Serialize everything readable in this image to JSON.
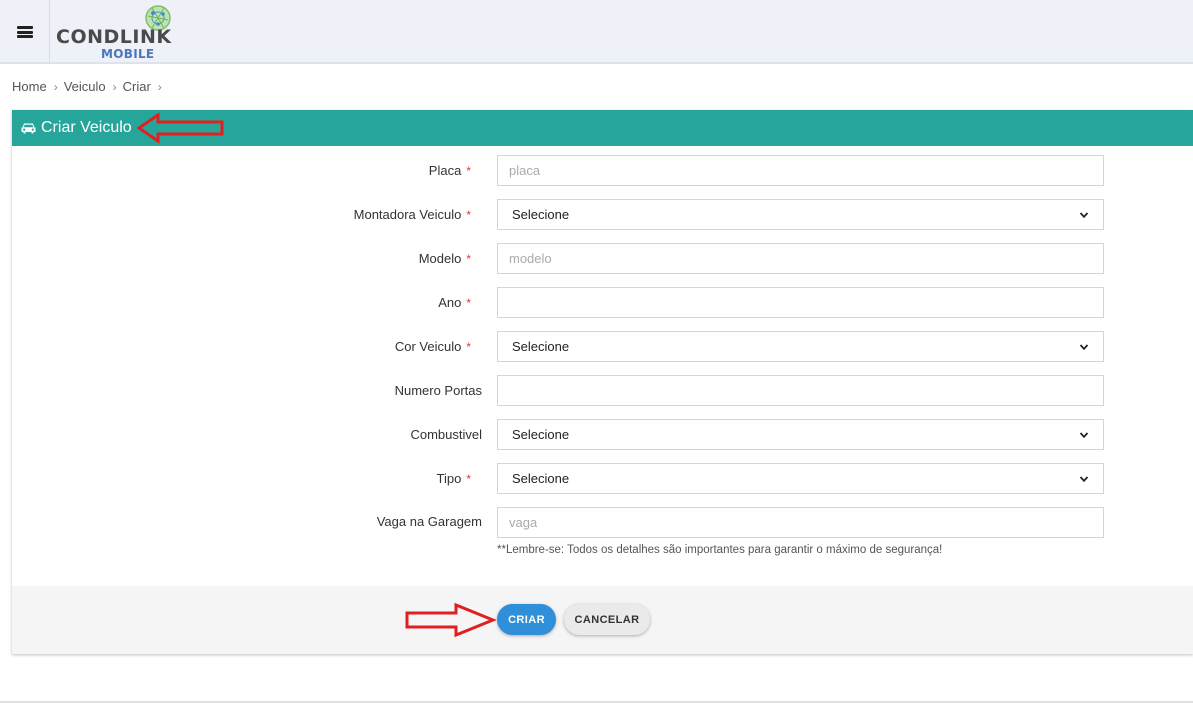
{
  "brand": {
    "name": "CONDLINK",
    "sub": "MOBILE"
  },
  "breadcrumb": [
    "Home",
    "Veiculo",
    "Criar"
  ],
  "card": {
    "title": "Criar Veiculo"
  },
  "form": {
    "fields": [
      {
        "label": "Placa",
        "required": true,
        "type": "input",
        "value": "",
        "placeholder": "placa"
      },
      {
        "label": "Montadora Veiculo",
        "required": true,
        "type": "select",
        "value": "Selecione"
      },
      {
        "label": "Modelo",
        "required": true,
        "type": "input",
        "value": "",
        "placeholder": "modelo"
      },
      {
        "label": "Ano",
        "required": true,
        "type": "input",
        "value": "",
        "placeholder": ""
      },
      {
        "label": "Cor Veiculo",
        "required": true,
        "type": "select",
        "value": "Selecione"
      },
      {
        "label": "Numero Portas",
        "required": false,
        "type": "input",
        "value": "",
        "placeholder": ""
      },
      {
        "label": "Combustivel",
        "required": false,
        "type": "select",
        "value": "Selecione"
      },
      {
        "label": "Tipo",
        "required": true,
        "type": "select",
        "value": "Selecione"
      },
      {
        "label": "Vaga na Garagem",
        "required": false,
        "type": "input",
        "value": "",
        "placeholder": "vaga"
      }
    ],
    "required_mark": "*",
    "hint": "**Lembre-se: Todos os detalhes são importantes para garantir o máximo de segurança!"
  },
  "actions": {
    "submit": "CRIAR",
    "cancel": "CANCELAR"
  },
  "colors": {
    "header": "#26a69a",
    "primary": "#2f8fd8",
    "required": "#e53935",
    "annotation": "#e02020"
  },
  "icons": {
    "menu": "hamburger-icon",
    "card": "car-icon",
    "select": "chevron-down-icon",
    "crumb": "chevron-right-icon"
  }
}
